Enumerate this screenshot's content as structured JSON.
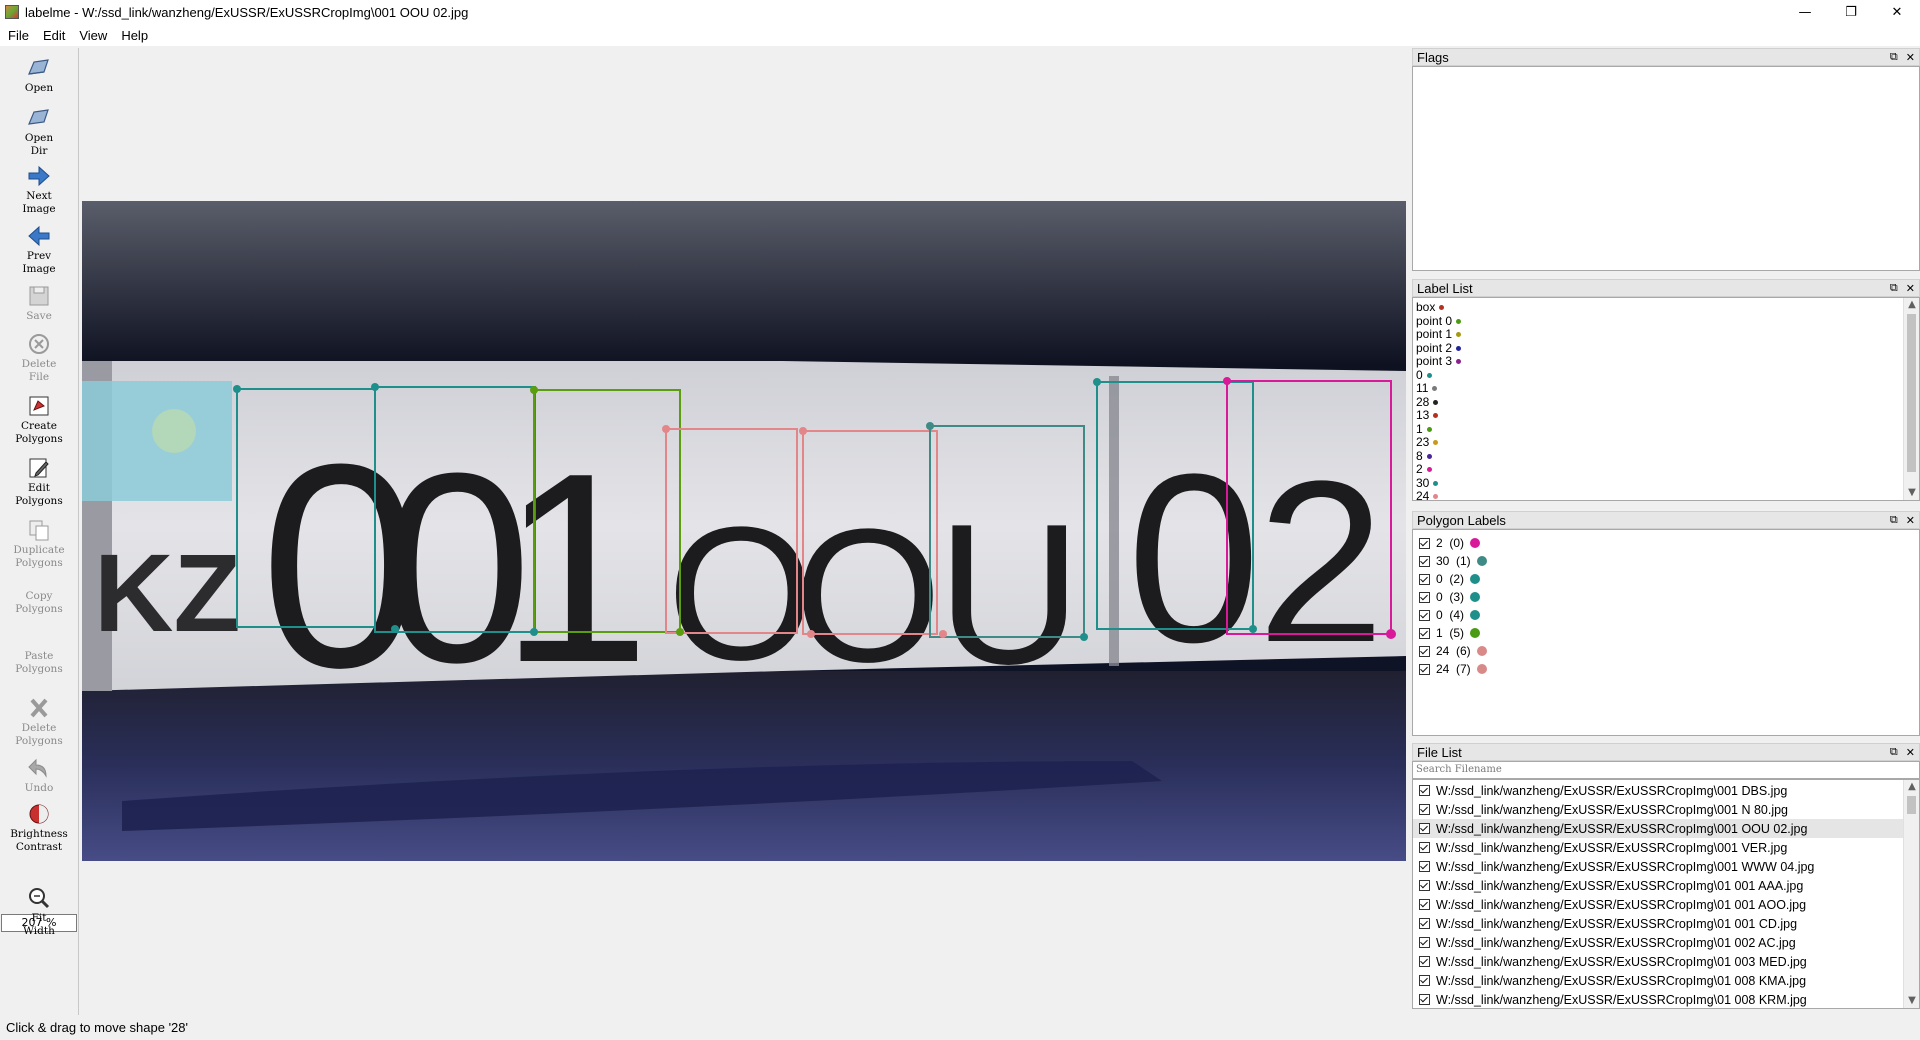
{
  "window": {
    "title": "labelme - W:/ssd_link/wanzheng/ExUSSR/ExUSSRCropImg\\001 OOU 02.jpg",
    "minimize_glyph": "—",
    "maximize_glyph": "❐",
    "close_glyph": "✕"
  },
  "menu": {
    "file": "File",
    "edit": "Edit",
    "view": "View",
    "help": "Help"
  },
  "toolbar": {
    "open": "Open",
    "open_dir_1": "Open",
    "open_dir_2": "Dir",
    "next_image_1": "Next",
    "next_image_2": "Image",
    "prev_image_1": "Prev",
    "prev_image_2": "Image",
    "save": "Save",
    "delete_file_1": "Delete",
    "delete_file_2": "File",
    "create_polygons_1": "Create",
    "create_polygons_2": "Polygons",
    "edit_polygons_1": "Edit",
    "edit_polygons_2": "Polygons",
    "duplicate_polygons_1": "Duplicate",
    "duplicate_polygons_2": "Polygons",
    "copy_polygons_1": "Copy",
    "copy_polygons_2": "Polygons",
    "paste_polygons_1": "Paste",
    "paste_polygons_2": "Polygons",
    "delete_polygons_1": "Delete",
    "delete_polygons_2": "Polygons",
    "undo": "Undo",
    "brightness_1": "Brightness",
    "brightness_2": "Contrast",
    "zoom_value": "207 %",
    "fit_width_1": "Fit",
    "fit_width_2": "Width"
  },
  "canvas": {
    "plate_text_left": "KZ",
    "plate_chars": [
      "0",
      "0",
      "1",
      "O",
      "O",
      "U",
      "0",
      "2"
    ],
    "colors": {
      "teal": "#1f8f8c",
      "green": "#5a9e10",
      "pink": "#e2868a",
      "magenta": "#d81a9a"
    }
  },
  "docks": {
    "flags_title": "Flags",
    "label_list_title": "Label List",
    "polygon_labels_title": "Polygon Labels",
    "file_list_title": "File List",
    "search_placeholder": "Search Filename",
    "float_glyph": "⧉",
    "close_glyph": "✕"
  },
  "label_list": [
    {
      "label": "box",
      "color": "#b4301f"
    },
    {
      "label": "point 0",
      "color": "#4a9a12"
    },
    {
      "label": "point 1",
      "color": "#a59a14"
    },
    {
      "label": "point 2",
      "color": "#24249a"
    },
    {
      "label": "point 3",
      "color": "#8a208a"
    },
    {
      "label": "0",
      "color": "#1f8f8c"
    },
    {
      "label": "11",
      "color": "#7a7a7a"
    },
    {
      "label": "28",
      "color": "#222222"
    },
    {
      "label": "13",
      "color": "#b4301f"
    },
    {
      "label": "1",
      "color": "#4a9a12"
    },
    {
      "label": "23",
      "color": "#c89a1a"
    },
    {
      "label": "8",
      "color": "#4a249a"
    },
    {
      "label": "2",
      "color": "#d81a9a"
    },
    {
      "label": "30",
      "color": "#1f8f8c"
    },
    {
      "label": "24",
      "color": "#e2868a"
    }
  ],
  "polygon_labels": [
    {
      "label": "2  (0)",
      "color": "#d81a9a"
    },
    {
      "label": "30  (1)",
      "color": "#3f8a86"
    },
    {
      "label": "0  (2)",
      "color": "#1f8f8c"
    },
    {
      "label": "0  (3)",
      "color": "#1f8f8c"
    },
    {
      "label": "0  (4)",
      "color": "#1f8f8c"
    },
    {
      "label": "1  (5)",
      "color": "#4a9a12"
    },
    {
      "label": "24  (6)",
      "color": "#d88a88"
    },
    {
      "label": "24  (7)",
      "color": "#d88a88"
    }
  ],
  "file_list": [
    "W:/ssd_link/wanzheng/ExUSSR/ExUSSRCropImg\\001 DBS.jpg",
    "W:/ssd_link/wanzheng/ExUSSR/ExUSSRCropImg\\001 N 80.jpg",
    "W:/ssd_link/wanzheng/ExUSSR/ExUSSRCropImg\\001 OOU 02.jpg",
    "W:/ssd_link/wanzheng/ExUSSR/ExUSSRCropImg\\001 VER.jpg",
    "W:/ssd_link/wanzheng/ExUSSR/ExUSSRCropImg\\001 WWW 04.jpg",
    "W:/ssd_link/wanzheng/ExUSSR/ExUSSRCropImg\\01 001 AAA.jpg",
    "W:/ssd_link/wanzheng/ExUSSR/ExUSSRCropImg\\01 001 AOO.jpg",
    "W:/ssd_link/wanzheng/ExUSSR/ExUSSRCropImg\\01 001 CD.jpg",
    "W:/ssd_link/wanzheng/ExUSSR/ExUSSRCropImg\\01 002 AC.jpg",
    "W:/ssd_link/wanzheng/ExUSSR/ExUSSRCropImg\\01 003 MED.jpg",
    "W:/ssd_link/wanzheng/ExUSSR/ExUSSRCropImg\\01 008 KMA.jpg",
    "W:/ssd_link/wanzheng/ExUSSR/ExUSSRCropImg\\01 008 KRM.jpg"
  ],
  "file_list_selected": 2,
  "status": "Click & drag to move shape '28'"
}
